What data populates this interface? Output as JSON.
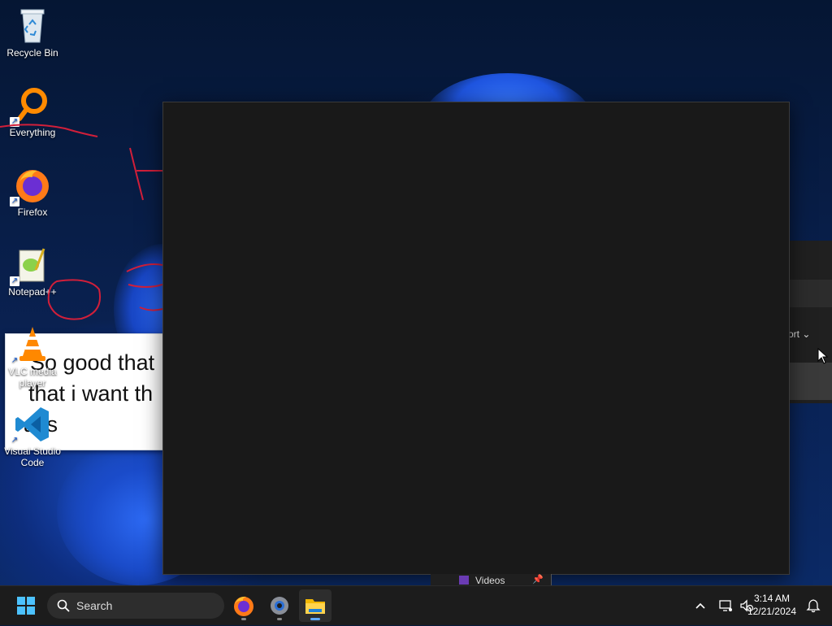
{
  "desktop": {
    "icons": [
      {
        "label": "Recycle Bin",
        "icon": "recycle-bin-icon"
      },
      {
        "label": "Everything",
        "icon": "everything-search-icon"
      },
      {
        "label": "Firefox",
        "icon": "firefox-icon"
      },
      {
        "label": "Notepad++",
        "icon": "notepadpp-icon"
      },
      {
        "label": "VLC media player",
        "icon": "vlc-icon"
      },
      {
        "label": "Visual Studio Code",
        "icon": "vscode-icon"
      }
    ]
  },
  "note_window": {
    "lines": [
      "So good that",
      "that i want th",
      "ass"
    ]
  },
  "background_explorer": {
    "sort_label": "ort",
    "sidebar_item": "Videos"
  },
  "taskbar": {
    "search_placeholder": "Search",
    "apps": [
      {
        "name": "Firefox",
        "icon": "firefox-icon"
      },
      {
        "name": "Settings",
        "icon": "gear-icon"
      },
      {
        "name": "File Explorer",
        "icon": "folder-icon"
      }
    ],
    "time": "3:14 AM",
    "date": "12/21/2024"
  },
  "colors": {
    "taskbar_bg": "#1c1c1c",
    "dark_window_bg": "#191919",
    "accent": "#5ea8ff"
  }
}
